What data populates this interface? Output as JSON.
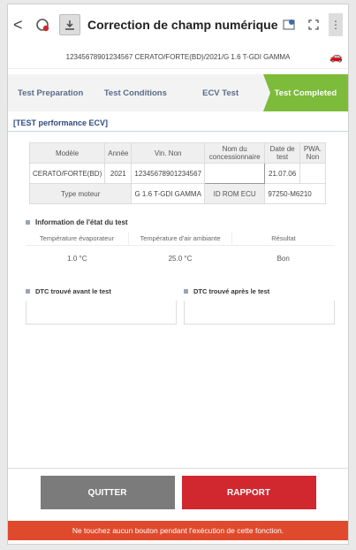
{
  "header": {
    "back": "<",
    "title": "Correction de champ numérique"
  },
  "vehicle_line": "12345678901234567  CERATO/FORTE(BD)/2021/G 1.6 T-GDI GAMMA",
  "steps": [
    {
      "label": "Test Preparation",
      "active": false
    },
    {
      "label": "Test Conditions",
      "active": false
    },
    {
      "label": "ECV Test",
      "active": false
    },
    {
      "label": "Test Completed",
      "active": true
    }
  ],
  "section_title": "[TEST performance ECV]",
  "info_table": {
    "modele_label": "Modèle",
    "annee_label": "Année",
    "vin_label": "Vin. Non",
    "nom_label": "Nom du concessionnaire",
    "date_label": "Date de test",
    "pwa_label": "PWA. Non",
    "modele_value": "CERATO/FORTE(BD)",
    "annee_value": "2021",
    "vin_value": "12345678901234567",
    "nom_value": "",
    "date_value": "21.07.06",
    "pwa_value": "",
    "type_moteur_label": "Type moteur",
    "type_moteur_value": "G 1.6 T-GDI GAMMA",
    "id_rom_label": "ID ROM ECU",
    "id_rom_value": "97250-M6210"
  },
  "state_info": {
    "title": "Information de l'état du test",
    "labels": [
      "Température évaporateur",
      "Température d'air ambiante",
      "Résultat"
    ],
    "values": [
      "1.0 °C",
      "25.0 °C",
      "Bon"
    ]
  },
  "dtc": {
    "before": "DTC trouvé avant le test",
    "after": "DTC trouvé après le test"
  },
  "buttons": {
    "quit": "QUITTER",
    "report": "RAPPORT"
  },
  "warning": "Ne touchez aucun bouton pendant l'exécution de cette fonction."
}
